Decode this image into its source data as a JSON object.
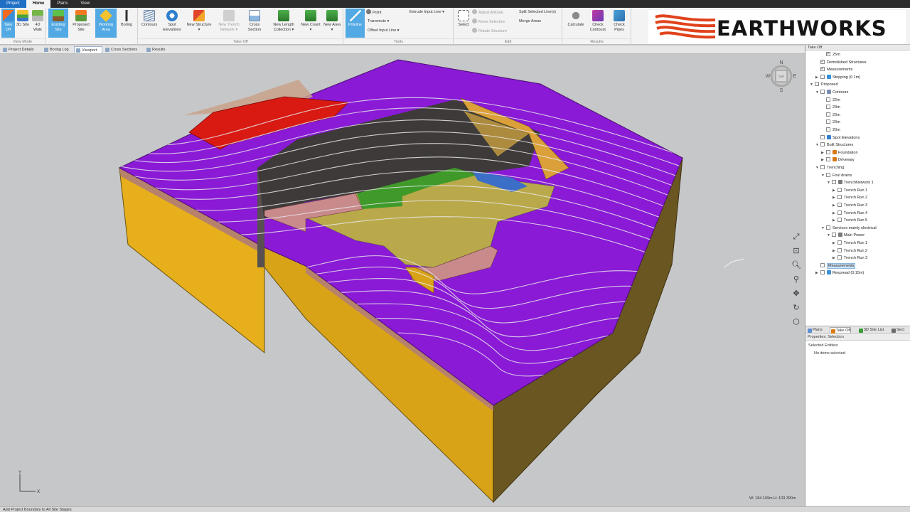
{
  "menu": {
    "tabs": [
      {
        "label": "Project"
      },
      {
        "label": "Home"
      },
      {
        "label": "Plans"
      },
      {
        "label": "View"
      }
    ]
  },
  "ribbon": {
    "view_mode": {
      "caption": "View Mode",
      "take_off": "Take Off",
      "site_3d": "3D Site",
      "walk_4d": "4D Walk"
    },
    "site": {
      "existing": "Existing Site",
      "proposed": "Proposed Site",
      "working_area": "Working Area",
      "boring": "Boring"
    },
    "take_off": {
      "caption": "Take Off",
      "contours": "Contours",
      "spot_elevations": "Spot Elevations",
      "new_structure": "New Structure",
      "new_trench_network": "New Trench Network",
      "cross_section": "Cross Section",
      "new_length_collection": "New Length Collection",
      "new_count": "New Count",
      "new_area": "New Area"
    },
    "tools": {
      "caption": "Tools",
      "polyline": "Polyline",
      "point": "Point",
      "transmute": "Transmute",
      "offset_input_line": "Offset Input Line",
      "extrude_input_line": "Extrude Input Line"
    },
    "edit": {
      "caption": "Edit",
      "select": "Select",
      "adjust_altitude": "Adjust Altitude",
      "move_selection": "Move Selection",
      "rotate_structure": "Rotate Structure",
      "split_selected_lines": "Split Selected Line(s)",
      "merge_areas": "Merge Areas"
    },
    "results": {
      "caption": "Results",
      "calculate": "Calculate",
      "check_contours": "Check Contours",
      "check_pipes": "Check Pipes"
    }
  },
  "logo": {
    "text": "EARTHWORKS"
  },
  "doc_tabs": [
    {
      "label": "Project Details"
    },
    {
      "label": "Boring Log"
    },
    {
      "label": "Viewport",
      "active": true
    },
    {
      "label": "Cross Sections"
    },
    {
      "label": "Results"
    }
  ],
  "viewport": {
    "compass": {
      "n": "N",
      "e": "E",
      "s": "S",
      "w": "W",
      "top": "TOP"
    },
    "dims_readout": "W: 184.169m  H: 103.390m",
    "axis_y": "Y",
    "axis_x": "X",
    "colors": {
      "surface": "#8a1ad6",
      "soil": "#e8b21c",
      "cut_floor": "#b9a94a",
      "demolished": "#d81a12",
      "pink_layer": "#c98a8c",
      "green_area": "#3f9a2a",
      "blue_area": "#3b6ec6"
    }
  },
  "panel": {
    "title": "Take Off",
    "tree": [
      {
        "label": "25m",
        "depth": 2,
        "toggle": "",
        "checked": true,
        "icon": ""
      },
      {
        "label": "Demolished Structures",
        "depth": 1,
        "toggle": "",
        "checked": true,
        "icon": ""
      },
      {
        "label": "Measurements",
        "depth": 1,
        "toggle": "",
        "checked": true,
        "icon": ""
      },
      {
        "label": "Stripping (0.1m)",
        "depth": 1,
        "toggle": "▶",
        "checked": false,
        "icon": "#3b8fd6"
      },
      {
        "label": "Proposed",
        "depth": 0,
        "toggle": "▼",
        "checked": false,
        "icon": ""
      },
      {
        "label": "Contours",
        "depth": 1,
        "toggle": "▼",
        "checked": false,
        "icon": "#7b8db0"
      },
      {
        "label": "22m",
        "depth": 2,
        "toggle": "",
        "checked": false,
        "icon": ""
      },
      {
        "label": "23m",
        "depth": 2,
        "toggle": "",
        "checked": false,
        "icon": ""
      },
      {
        "label": "23m",
        "depth": 2,
        "toggle": "",
        "checked": false,
        "icon": ""
      },
      {
        "label": "23m",
        "depth": 2,
        "toggle": "",
        "checked": false,
        "icon": ""
      },
      {
        "label": "20m",
        "depth": 2,
        "toggle": "",
        "checked": false,
        "icon": ""
      },
      {
        "label": "Spot Elevations",
        "depth": 1,
        "toggle": "",
        "checked": false,
        "icon": "#2f7fcf"
      },
      {
        "label": "Built Structures",
        "depth": 1,
        "toggle": "▼",
        "checked": false,
        "icon": ""
      },
      {
        "label": "Foundation",
        "depth": 2,
        "toggle": "▶",
        "checked": false,
        "icon": "#d87a18"
      },
      {
        "label": "Driveway",
        "depth": 2,
        "toggle": "▶",
        "checked": false,
        "icon": "#d87a18"
      },
      {
        "label": "Trenching",
        "depth": 1,
        "toggle": "▼",
        "checked": false,
        "icon": ""
      },
      {
        "label": "Foul drains",
        "depth": 2,
        "toggle": "▼",
        "checked": false,
        "icon": ""
      },
      {
        "label": "TrenchNetwork 1",
        "depth": 3,
        "toggle": "▼",
        "checked": false,
        "icon": "#7a7a7a"
      },
      {
        "label": "Trench Run 1",
        "depth": 4,
        "toggle": "▶",
        "checked": false,
        "icon": ""
      },
      {
        "label": "Trench Run 2",
        "depth": 4,
        "toggle": "▶",
        "checked": false,
        "icon": ""
      },
      {
        "label": "Trench Run 3",
        "depth": 4,
        "toggle": "▶",
        "checked": false,
        "icon": ""
      },
      {
        "label": "Trench Run 4",
        "depth": 4,
        "toggle": "▶",
        "checked": false,
        "icon": ""
      },
      {
        "label": "Trench Run 5",
        "depth": 4,
        "toggle": "▶",
        "checked": false,
        "icon": ""
      },
      {
        "label": "Services mainly electrical",
        "depth": 2,
        "toggle": "▼",
        "checked": false,
        "icon": ""
      },
      {
        "label": "Main Power",
        "depth": 3,
        "toggle": "▼",
        "checked": false,
        "icon": "#7a7a7a"
      },
      {
        "label": "Trench Run 1",
        "depth": 4,
        "toggle": "▶",
        "checked": false,
        "icon": ""
      },
      {
        "label": "Trench Run 2",
        "depth": 4,
        "toggle": "▶",
        "checked": false,
        "icon": ""
      },
      {
        "label": "Trench Run 3",
        "depth": 4,
        "toggle": "▶",
        "checked": false,
        "icon": ""
      },
      {
        "label": "Measurements",
        "depth": 1,
        "toggle": "",
        "checked": false,
        "icon": "",
        "selected": true
      },
      {
        "label": "Respread (0.15m)",
        "depth": 1,
        "toggle": "▶",
        "checked": false,
        "icon": "#3b8fd6"
      }
    ],
    "tabs": [
      {
        "label": "Plans",
        "icon": "#5b8fd1"
      },
      {
        "label": "Take Off",
        "icon": "#d87a18",
        "active": true
      },
      {
        "label": "3D Site List",
        "icon": "#3a9a3a"
      },
      {
        "label": "Sect",
        "icon": "#6b6b6b"
      }
    ],
    "properties": {
      "title": "Properties: Selection",
      "selected_label": "Selected Entities:",
      "selected_value": "No items selected."
    }
  },
  "status": {
    "text": "Add Project Boundary to All Site Stages"
  }
}
